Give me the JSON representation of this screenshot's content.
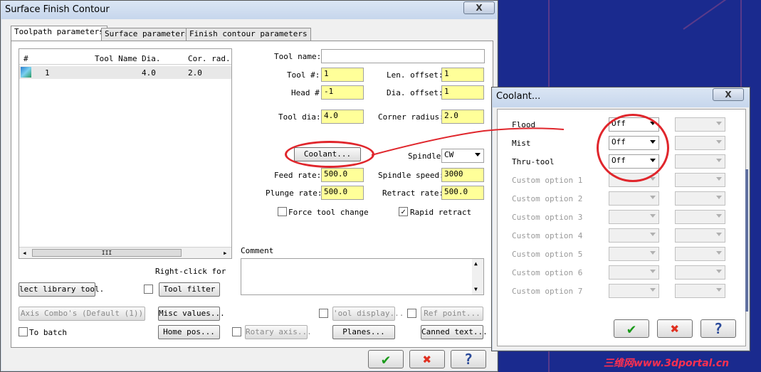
{
  "main": {
    "title": "Surface Finish Contour",
    "close": "X",
    "tabs": [
      "Toolpath parameters",
      "Surface parameters",
      "Finish contour parameters"
    ],
    "list_headers": [
      "#",
      "Tool Name",
      "Dia.",
      "Cor. rad."
    ],
    "list_row": {
      "num": "1",
      "name": "",
      "dia": "4.0",
      "cor": "2.0"
    },
    "scroll_thumb": "III",
    "tool_name_label": "Tool name:",
    "tool_name_value": "",
    "tool_num_label": "Tool #:",
    "tool_num_value": "1",
    "len_offset_label": "Len. offset:",
    "len_offset_value": "1",
    "head_label": "Head #",
    "head_value": "-1",
    "dia_offset_label": "Dia. offset:",
    "dia_offset_value": "1",
    "tool_dia_label": "Tool dia:",
    "tool_dia_value": "4.0",
    "corner_radius_label": "Corner radius:",
    "corner_radius_value": "2.0",
    "coolant_button": "Coolant...",
    "spindle_label": "Spindle",
    "spindle_value": "CW",
    "feed_rate_label": "Feed rate:",
    "feed_rate_value": "500.0",
    "spindle_speed_label": "Spindle speed:",
    "spindle_speed_value": "3000",
    "plunge_rate_label": "Plunge rate:",
    "plunge_rate_value": "500.0",
    "retract_rate_label": "Retract rate:",
    "retract_rate_value": "500.0",
    "force_tool_change": "Force tool change",
    "rapid_retract": "Rapid retract",
    "comment_label": "Comment",
    "right_click_label": "Right-click for",
    "select_library_tool": "lect library tool.",
    "tool_filter": "Tool filter",
    "axis_combo": "Axis Combo's (Default (1))",
    "misc_values": "Misc values...",
    "tool_display": "'ool display...",
    "ref_point": "Ref point...",
    "to_batch": "To batch",
    "home_pos": "Home pos...",
    "rotary_axis": "Rotary axis...",
    "planes": "Planes...",
    "canned_text": "Canned text...",
    "ok": "✔",
    "cancel": "✖",
    "help": "?"
  },
  "coolant": {
    "title": "Coolant...",
    "close": "X",
    "rows": [
      {
        "label": "Flood",
        "value": "Off"
      },
      {
        "label": "Mist",
        "value": "Off"
      },
      {
        "label": "Thru-tool",
        "value": "Off"
      },
      {
        "label": "Custom option 1",
        "value": ""
      },
      {
        "label": "Custom option 2",
        "value": ""
      },
      {
        "label": "Custom option 3",
        "value": ""
      },
      {
        "label": "Custom option 4",
        "value": ""
      },
      {
        "label": "Custom option 5",
        "value": ""
      },
      {
        "label": "Custom option 6",
        "value": ""
      },
      {
        "label": "Custom option 7",
        "value": ""
      }
    ],
    "ok": "✔",
    "cancel": "✖",
    "help": "?"
  },
  "watermark": "三维网www.3dportal.cn",
  "colors": {
    "highlight_input": "#ffff99",
    "annotation": "#e0262c",
    "desktop": "#1a2a8e"
  }
}
